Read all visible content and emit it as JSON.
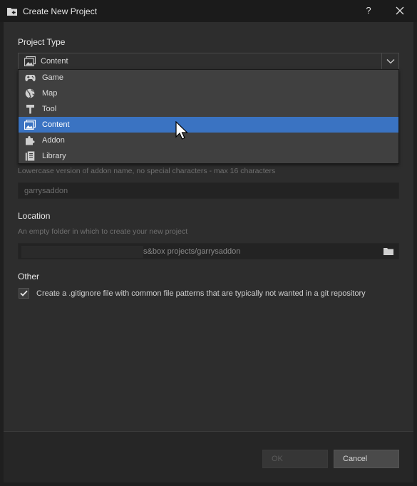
{
  "window": {
    "title": "Create New Project",
    "help_label": "?",
    "close_icon": "close-icon"
  },
  "project_type": {
    "label": "Project Type",
    "selected": "Content",
    "options": [
      {
        "label": "Game",
        "icon": "gamepad-icon"
      },
      {
        "label": "Map",
        "icon": "globe-icon"
      },
      {
        "label": "Tool",
        "icon": "hammer-icon"
      },
      {
        "label": "Content",
        "icon": "image-icon"
      },
      {
        "label": "Addon",
        "icon": "puzzle-icon"
      },
      {
        "label": "Library",
        "icon": "library-icon"
      }
    ],
    "selected_index": 3
  },
  "ident": {
    "hint": "Lowercase version of addon name, no special characters - max 16 characters",
    "value": "garrysaddon"
  },
  "location": {
    "label": "Location",
    "hint": "An empty folder in which to create your new project",
    "value": "s&box projects/garrysaddon"
  },
  "other": {
    "label": "Other",
    "gitignore_label": "Create a .gitignore file with common file patterns that are typically not wanted in a git repository",
    "gitignore_checked": true
  },
  "buttons": {
    "ok_label": "OK",
    "cancel_label": "Cancel"
  },
  "colors": {
    "accent": "#3a73c2",
    "background": "#2d2d2d",
    "titlebar": "#1b1b1b"
  }
}
